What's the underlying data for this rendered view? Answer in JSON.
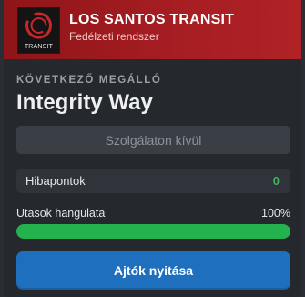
{
  "header": {
    "title": "LOS SANTOS TRANSIT",
    "subtitle": "Fedélzeti rendszer",
    "logo_text": "TRANSIT",
    "accent_color": "#a51d22"
  },
  "next_stop": {
    "label": "KÖVETKEZŐ MEGÁLLÓ",
    "name": "Integrity Way"
  },
  "status_button": {
    "label": "Szolgálaton kívül"
  },
  "penalty": {
    "label": "Hibapontok",
    "value": "0"
  },
  "passenger_mood": {
    "label": "Utasok hangulata",
    "value_text": "100%",
    "fraction": 1.0,
    "bar_color": "#23b24d"
  },
  "doors_button": {
    "label": "Ajtók nyitása",
    "color": "#1f6fbf"
  },
  "icons": {
    "logo": "transit-logo-icon"
  }
}
